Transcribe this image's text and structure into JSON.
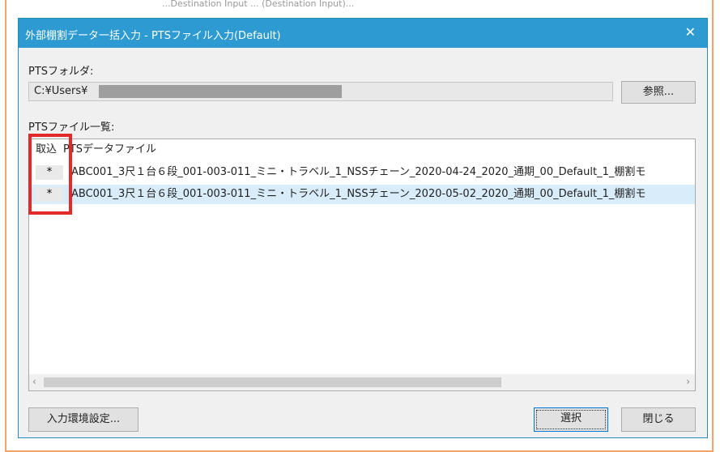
{
  "background_text": "...Destination Input ... (Destination Input)...",
  "window": {
    "title": "外部棚割データ一括入力 - PTSファイル入力(Default)",
    "close_symbol": "✕"
  },
  "folder": {
    "label": "PTSフォルダ:",
    "path_value": "C:¥Users¥",
    "browse_label": "参照..."
  },
  "file_list": {
    "label": "PTSファイル一覧:",
    "columns": [
      "取込",
      "PTSデータファイル"
    ],
    "rows": [
      {
        "check": "*",
        "file": "ABC001_3尺１台６段_001-003-011_ミニ・トラベル_1_NSSチェーン_2020-04-24_2020_通期_00_Default_1_棚割モ"
      },
      {
        "check": "*",
        "file": "ABC001_3尺１台６段_001-003-011_ミニ・トラベル_1_NSSチェーン_2020-05-02_2020_通期_00_Default_1_棚割モ"
      }
    ]
  },
  "buttons": {
    "env_settings": "入力環境設定...",
    "select": "選択",
    "close": "閉じる"
  },
  "colors": {
    "titlebar": "#2d9bd2",
    "highlight_box": "#e32a2a",
    "frame": "#f2a36a"
  }
}
